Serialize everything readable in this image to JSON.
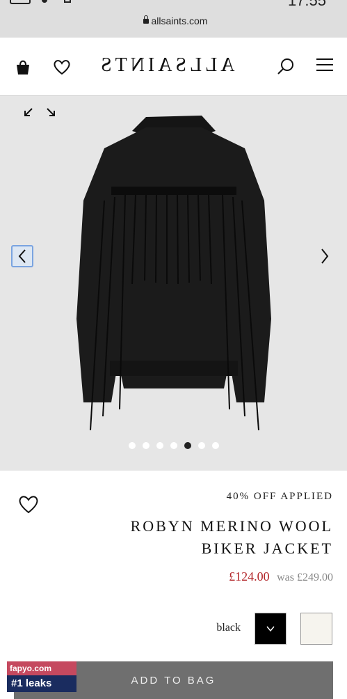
{
  "status_bar": {
    "time": "17:55"
  },
  "browser": {
    "url": "allsaints.com"
  },
  "header": {
    "logo": "ALLSAINTS"
  },
  "gallery": {
    "dots": 7,
    "active_index": 4
  },
  "product": {
    "discount_label": "40% OFF APPLIED",
    "title": "ROBYN MERINO WOOL BIKER JACKET",
    "price_now": "£124.00",
    "price_was": "was £249.00"
  },
  "colors": {
    "selected_label": "black",
    "options": [
      "black",
      "cream"
    ],
    "price_now_color": "#b3262a"
  },
  "actions": {
    "add_to_bag": "ADD TO BAG"
  },
  "watermark": {
    "site": "fapyo.com",
    "tagline": "#1 leaks"
  },
  "icons": [
    "bag-icon",
    "heart-icon",
    "search-icon",
    "menu-icon",
    "expand-icon",
    "chevron-left-icon",
    "chevron-right-icon",
    "chevron-down-icon"
  ]
}
